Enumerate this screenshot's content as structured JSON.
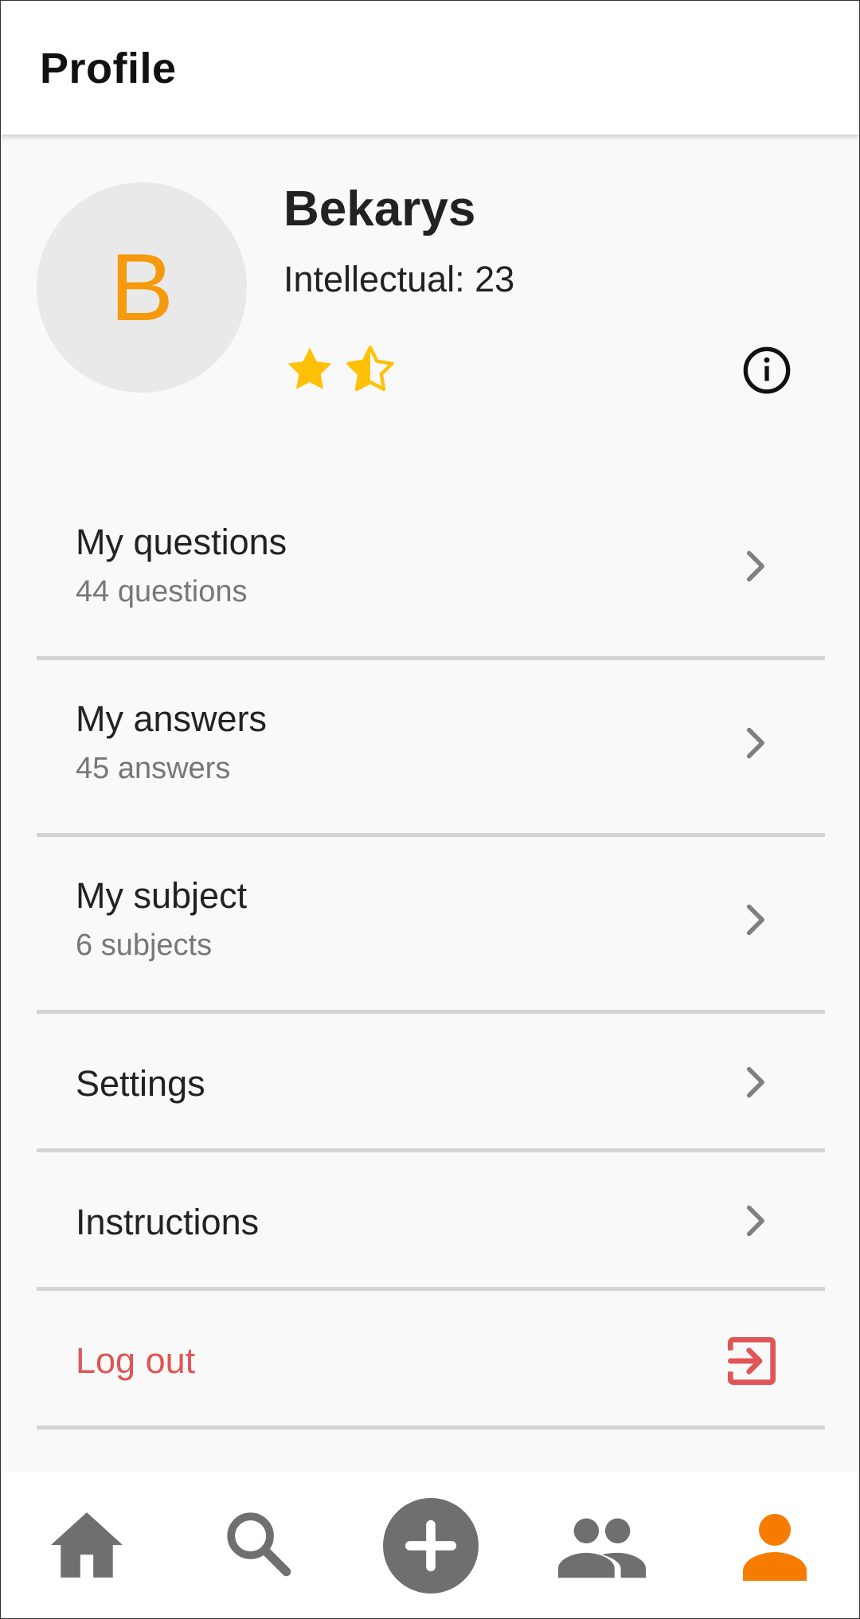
{
  "header": {
    "title": "Profile"
  },
  "profile": {
    "avatar_letter": "B",
    "name": "Bekarys",
    "score_text": "Intellectual: 23",
    "rating": 1.5,
    "rating_max": 2
  },
  "menu": {
    "questions": {
      "label": "My questions",
      "sub": "44 questions"
    },
    "answers": {
      "label": "My answers",
      "sub": "45 answers"
    },
    "subjects": {
      "label": "My subject",
      "sub": "6 subjects"
    },
    "settings": {
      "label": "Settings"
    },
    "instructions": {
      "label": "Instructions"
    },
    "logout": {
      "label": "Log out"
    }
  },
  "bottom_nav": {
    "items": [
      "home-icon",
      "search-icon",
      "add-icon",
      "friends-icon",
      "profile-icon"
    ],
    "active": "profile-icon"
  },
  "colors": {
    "accent": "#f59a0c",
    "active_nav": "#f57c00",
    "inactive_nav": "#6f6f6f",
    "star": "#ffc107",
    "logout": "#e05555"
  }
}
